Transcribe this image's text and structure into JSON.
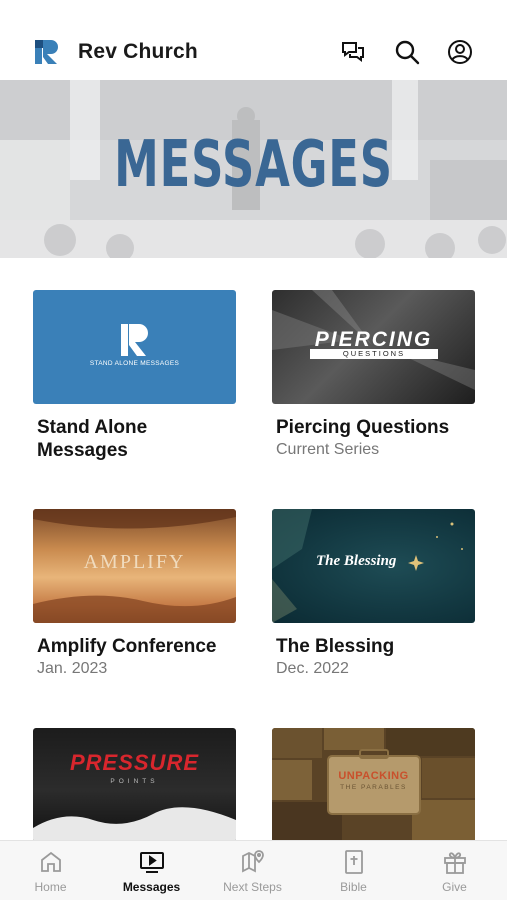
{
  "header": {
    "app_title": "Rev Church",
    "icons": [
      "rev-logo-icon",
      "chat-icon",
      "search-icon",
      "account-icon"
    ]
  },
  "hero": {
    "title": "MESSAGES"
  },
  "series": [
    {
      "title": "Stand Alone Messages",
      "subtitle": "",
      "thumb_text": "STAND ALONE MESSAGES"
    },
    {
      "title": "Piercing Questions",
      "subtitle": "Current Series",
      "thumb_text": "PIERCING",
      "thumb_subtext": "QUESTIONS"
    },
    {
      "title": "Amplify Conference",
      "subtitle": "Jan. 2023",
      "thumb_text": "AMPLIFY"
    },
    {
      "title": "The Blessing",
      "subtitle": "Dec. 2022",
      "thumb_text": "The Blessing"
    },
    {
      "title": "",
      "subtitle": "",
      "thumb_text": "PRESSURE",
      "thumb_subtext": "POINTS"
    },
    {
      "title": "",
      "subtitle": "",
      "thumb_text": "UNPACKING",
      "thumb_subtext": "THE PARABLES"
    }
  ],
  "tabbar": {
    "items": [
      {
        "label": "Home",
        "icon": "home-icon",
        "active": false
      },
      {
        "label": "Messages",
        "icon": "tv-play-icon",
        "active": true
      },
      {
        "label": "Next Steps",
        "icon": "map-pin-icon",
        "active": false
      },
      {
        "label": "Bible",
        "icon": "bible-icon",
        "active": false
      },
      {
        "label": "Give",
        "icon": "gift-icon",
        "active": false
      }
    ]
  },
  "colors": {
    "brand_blue": "#3a6794",
    "stand_alone_bg": "#3a80b8",
    "tab_active": "#111111",
    "tab_inactive": "#9a9a9a"
  }
}
